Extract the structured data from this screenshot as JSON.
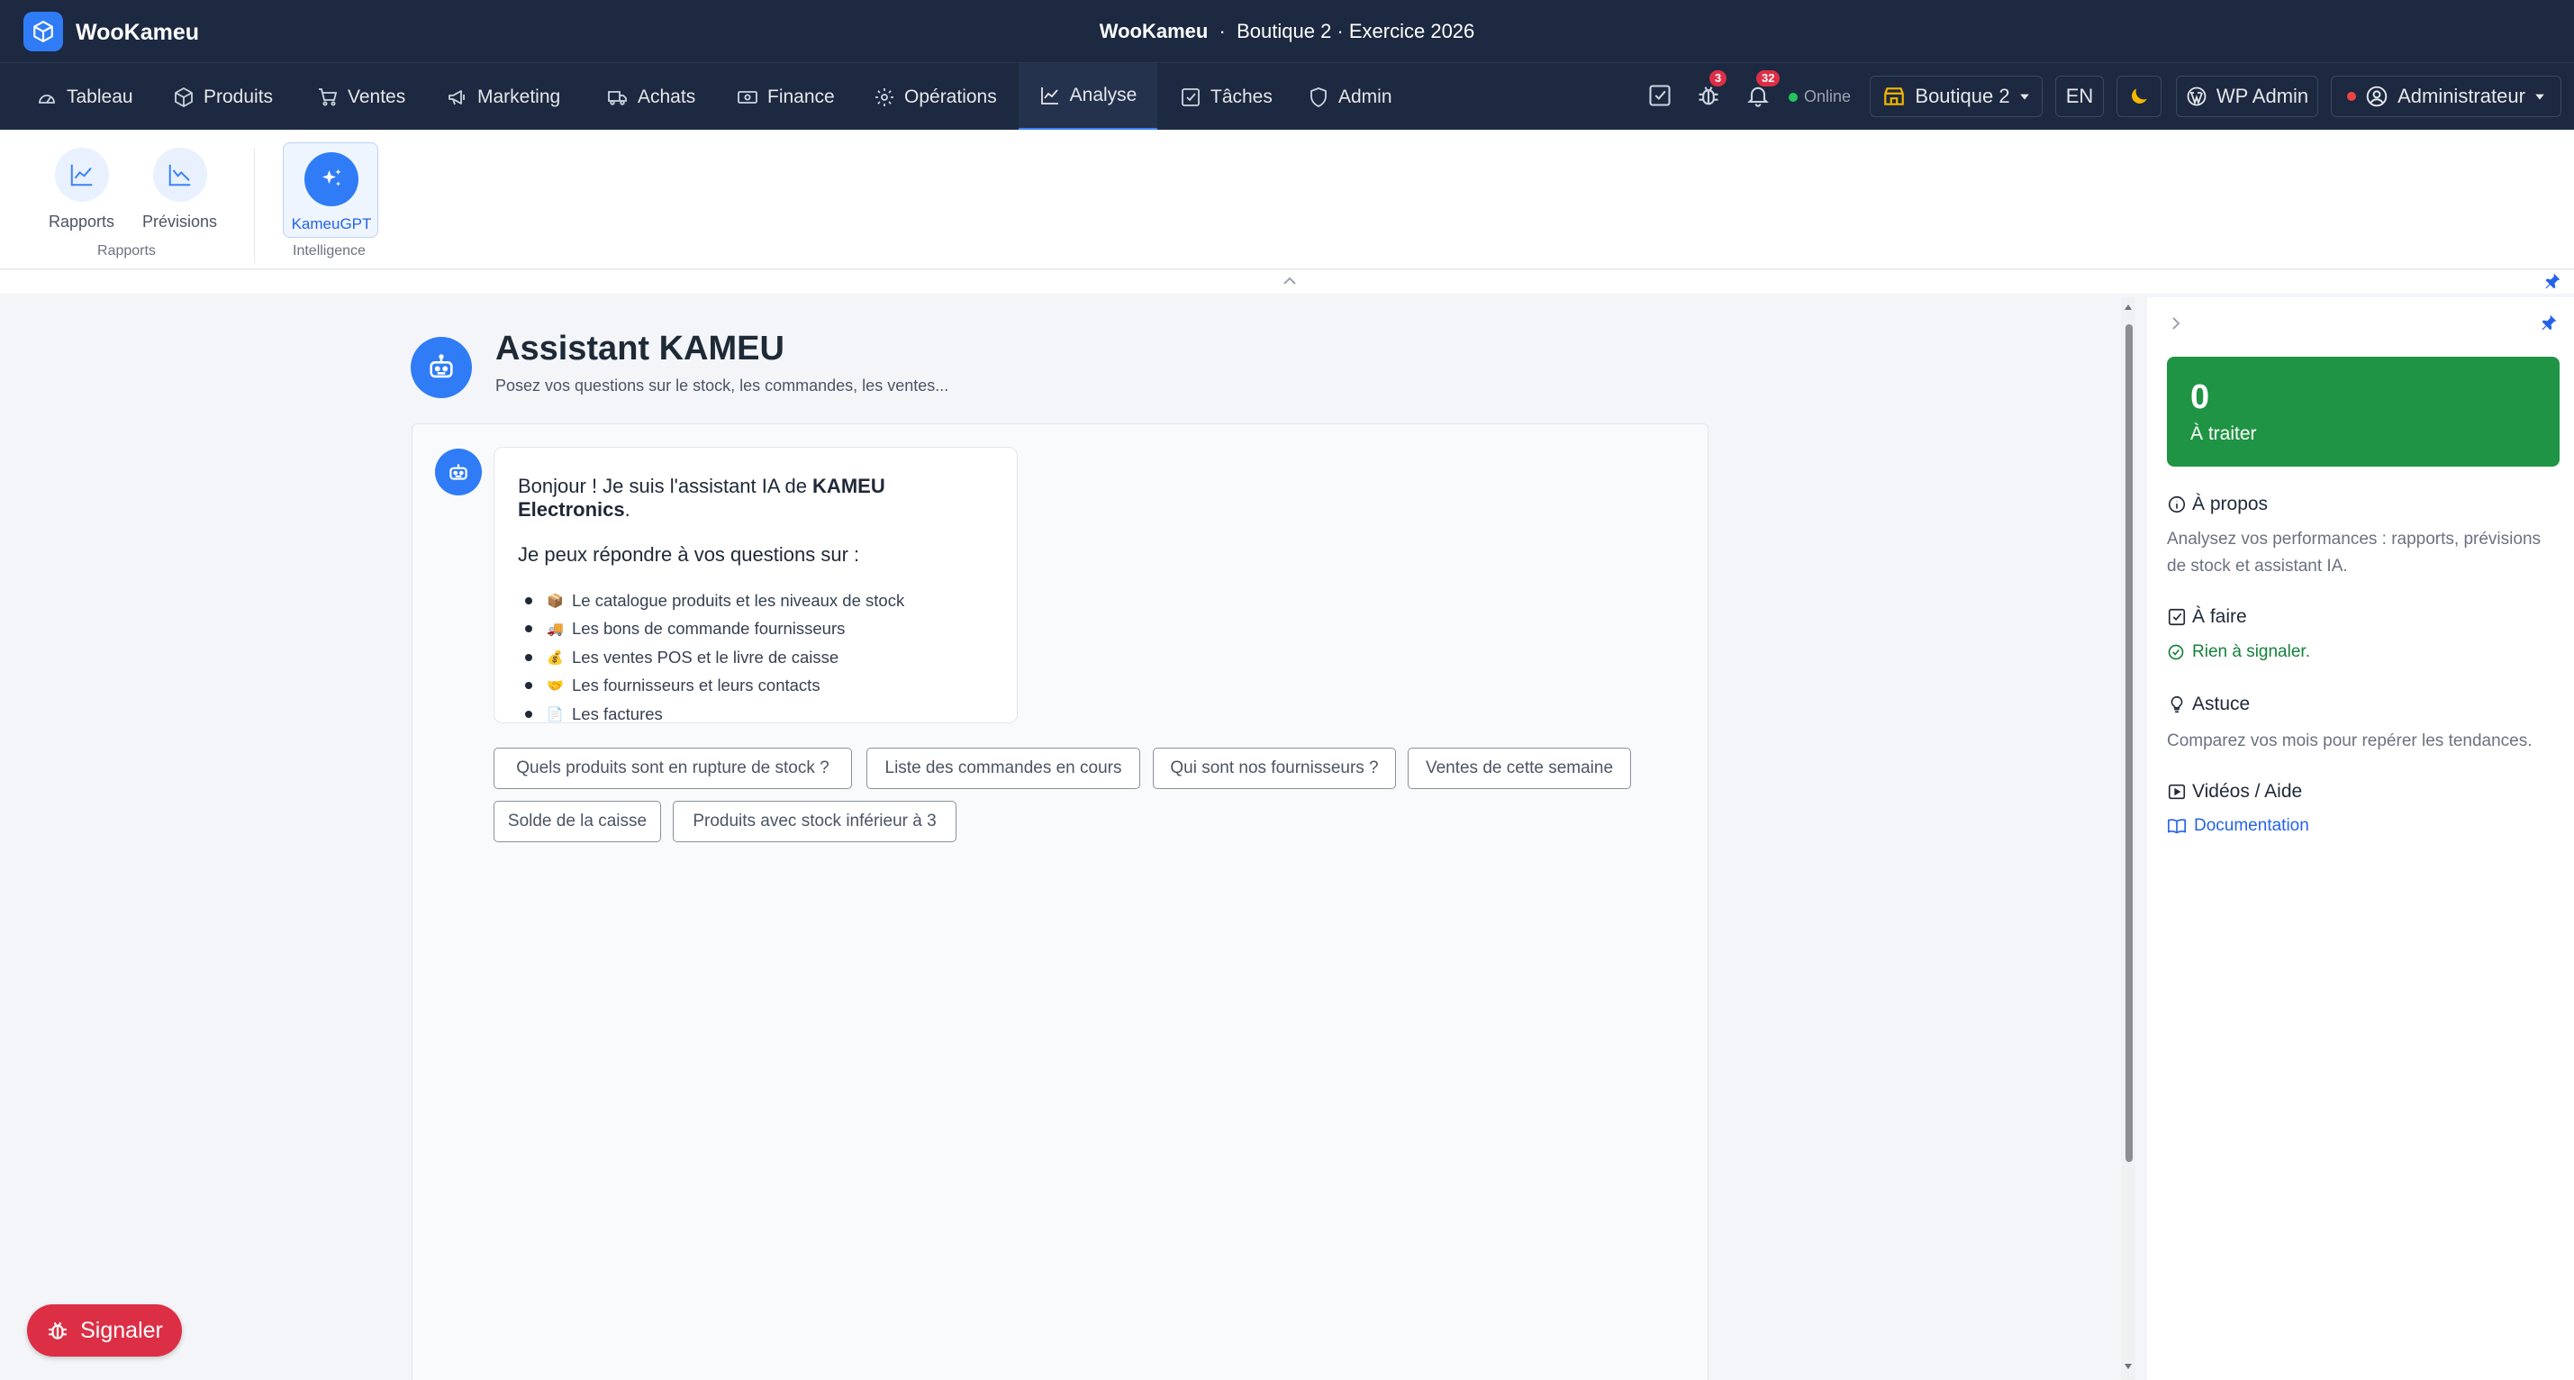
{
  "app": {
    "name": "WooKameu"
  },
  "window": {
    "title_app": "WooKameu",
    "title_sep": "·",
    "title_context": "Boutique 2 · Exercice 2026"
  },
  "nav": {
    "items": [
      {
        "label": "Tableau",
        "icon": "gauge-icon"
      },
      {
        "label": "Produits",
        "icon": "box-icon"
      },
      {
        "label": "Ventes",
        "icon": "cart-icon"
      },
      {
        "label": "Marketing",
        "icon": "megaphone-icon"
      },
      {
        "label": "Achats",
        "icon": "truck-icon"
      },
      {
        "label": "Finance",
        "icon": "cash-icon"
      },
      {
        "label": "Opérations",
        "icon": "gear-icon"
      },
      {
        "label": "Analyse",
        "icon": "chart-line-icon",
        "active": true
      },
      {
        "label": "Tâches",
        "icon": "checkbox-icon"
      },
      {
        "label": "Admin",
        "icon": "shield-icon"
      }
    ],
    "bug_badge": "3",
    "notif_badge": "32",
    "status": "Online",
    "store": "Boutique 2",
    "lang": "EN",
    "wp_admin": "WP Admin",
    "user": "Administrateur"
  },
  "ribbon": {
    "rapports_label": "Rapports",
    "previsions_label": "Prévisions",
    "group_rapports": "Rapports",
    "kameugpt_label": "KameuGPT",
    "group_intelligence": "Intelligence"
  },
  "page": {
    "title": "Assistant KAMEU",
    "subtitle": "Posez vos questions sur le stock, les commandes, les ventes..."
  },
  "chat": {
    "greeting_prefix": "Bonjour ! Je suis l'assistant IA de ",
    "greeting_brand": "KAMEU Electronics",
    "greeting_suffix": ".",
    "intro": "Je peux répondre à vos questions sur :",
    "topics": [
      {
        "emoji": "📦",
        "text": "Le catalogue produits et les niveaux de stock"
      },
      {
        "emoji": "🚚",
        "text": "Les bons de commande fournisseurs"
      },
      {
        "emoji": "💰",
        "text": "Les ventes POS et le livre de caisse"
      },
      {
        "emoji": "🤝",
        "text": "Les fournisseurs et leurs contacts"
      },
      {
        "emoji": "📄",
        "text": "Les factures"
      }
    ],
    "suggestions": [
      "Quels produits sont en rupture de stock ?",
      "Liste des commandes en cours",
      "Qui sont nos fournisseurs ?",
      "Ventes de cette semaine",
      "Solde de la caisse",
      "Produits avec stock inférieur à 3"
    ]
  },
  "sidebar": {
    "stat_value": "0",
    "stat_label": "À traiter",
    "apropos_title": "À propos",
    "apropos_text_1": "Analysez vos performances : rapports, prévisions",
    "apropos_text_2": "de stock et assistant IA.",
    "afaire_title": "À faire",
    "afaire_text": "Rien à signaler.",
    "astuce_title": "Astuce",
    "astuce_text": "Comparez vos mois pour repérer les tendances.",
    "videos_title": "Vidéos / Aide",
    "doc_link": "Documentation"
  },
  "report_button": "Signaler",
  "colors": {
    "navy": "#1c2940",
    "accent": "#2f7cf6",
    "success": "#1f9444",
    "danger": "#dc2f45"
  }
}
